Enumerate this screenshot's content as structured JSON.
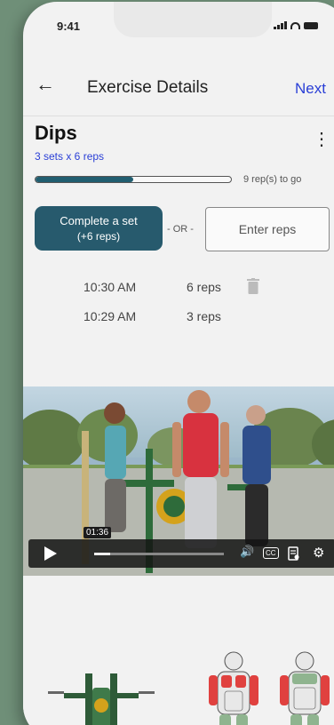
{
  "status_bar": {
    "time": "9:41"
  },
  "header": {
    "title": "Exercise Details",
    "next_label": "Next"
  },
  "exercise": {
    "name": "Dips",
    "sets_label": "3 sets x 6 reps",
    "progress_fraction": 0.5,
    "remaining_label": "9 rep(s) to go"
  },
  "actions": {
    "complete_line1": "Complete a set",
    "complete_line2": "(+6 reps)",
    "or_label": "- OR -",
    "enter_reps_placeholder": "Enter reps"
  },
  "log": [
    {
      "time": "10:30 AM",
      "reps": "6 reps"
    },
    {
      "time": "10:29 AM",
      "reps": "3 reps"
    }
  ],
  "video": {
    "timestamp": "01:36",
    "progress_fraction": 0.12,
    "cc_label": "CC"
  },
  "colors": {
    "accent": "#275a6d",
    "link": "#2a3fd6",
    "muscle_highlight": "#e0413f"
  },
  "icons": [
    "back-arrow-icon",
    "more-vert-icon",
    "trash-icon",
    "play-icon",
    "volume-icon",
    "cc-icon",
    "settings-icon"
  ]
}
